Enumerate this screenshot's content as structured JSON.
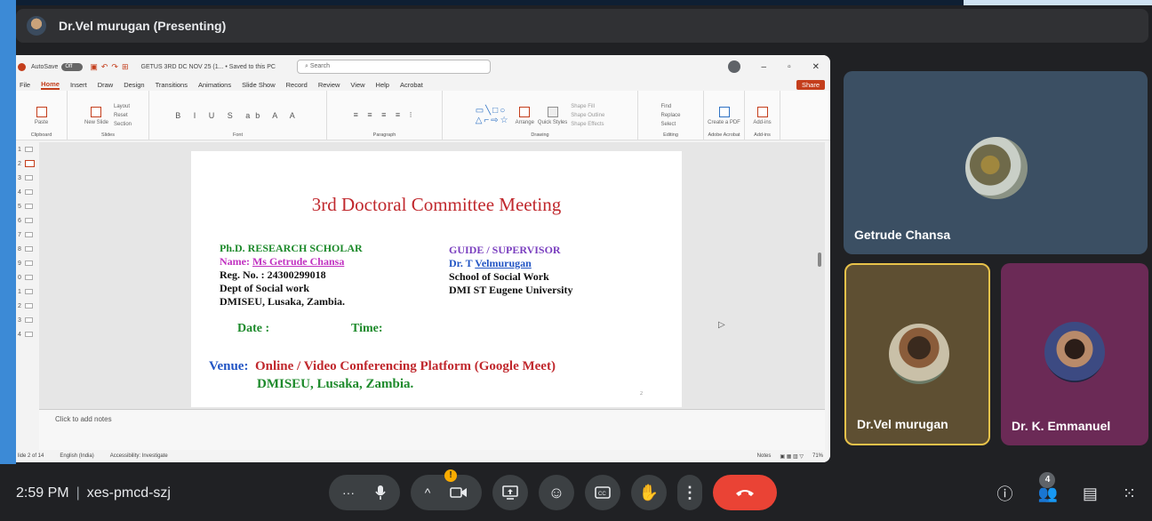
{
  "banner": {
    "title": "Dr.Vel murugan (Presenting)"
  },
  "powerpoint": {
    "autosave_label": "AutoSave",
    "autosave_state": "Off",
    "filename": "GETUS 3RD DC NOV 25 (1... • Saved to this PC",
    "search_placeholder": "Search",
    "tabs": [
      "File",
      "Home",
      "Insert",
      "Draw",
      "Design",
      "Transitions",
      "Animations",
      "Slide Show",
      "Record",
      "Review",
      "View",
      "Help",
      "Acrobat"
    ],
    "share_label": "Share",
    "groups": [
      "Clipboard",
      "Slides",
      "Font",
      "Paragraph",
      "Drawing",
      "Editing",
      "Adobe Acrobat",
      "Add-ins"
    ],
    "ribbon_items": {
      "paste": "Paste",
      "new_slide": "New Slide",
      "layout": "Layout",
      "reset": "Reset",
      "section": "Section",
      "arrange": "Arrange",
      "quick_styles": "Quick Styles",
      "shape_fill": "Shape Fill",
      "shape_outline": "Shape Outline",
      "shape_effects": "Shape Effects",
      "find": "Find",
      "replace": "Replace",
      "select": "Select",
      "create_pdf": "Create a PDF",
      "add_ins": "Add-ins"
    },
    "thumb_numbers": [
      "1",
      "2",
      "3",
      "4",
      "5",
      "6",
      "7",
      "8",
      "9",
      "0",
      "1",
      "2",
      "3",
      "4"
    ],
    "notes_placeholder": "Click to add notes",
    "status": {
      "slide_of": "lide 2 of 14",
      "language": "English (India)",
      "accessibility": "Accessibility: Investigate",
      "notes": "Notes",
      "zoom": "71%"
    },
    "slide": {
      "title": "3rd   Doctoral Committee Meeting",
      "scholar_heading": "Ph.D. RESEARCH SCHOLAR",
      "name_label": "Name: ",
      "name_value": "Ms Getrude Chansa",
      "reg": "Reg. No. : 24300299018",
      "dept": "Dept of Social work",
      "place": "DMISEU, Lusaka, Zambia.",
      "guide_heading": "GUIDE / SUPERVISOR",
      "guide_prefix": "Dr. T ",
      "guide_name": "Velmurugan",
      "school": "School of Social Work",
      "university": "DMI ST Eugene University",
      "date_label": "Date :",
      "time_label": "Time:",
      "venue_label": "Venue:",
      "venue_text": "Online / Video Conferencing Platform (Google Meet)",
      "venue_place": "DMISEU, Lusaka, Zambia.",
      "page_no": "2"
    }
  },
  "participants": [
    {
      "name": "Getrude Chansa"
    },
    {
      "name": "Dr.Vel murugan"
    },
    {
      "name": "Dr. K. Emmanuel"
    }
  ],
  "bottom_bar": {
    "time": "2:59 PM",
    "meeting_code": "xes-pmcd-szj",
    "people_count": "4",
    "warn_badge": "!"
  },
  "colors": {
    "accent_powerpoint": "#c43e1c",
    "end_call": "#ea4335",
    "speaking_border": "#e8c24a"
  }
}
